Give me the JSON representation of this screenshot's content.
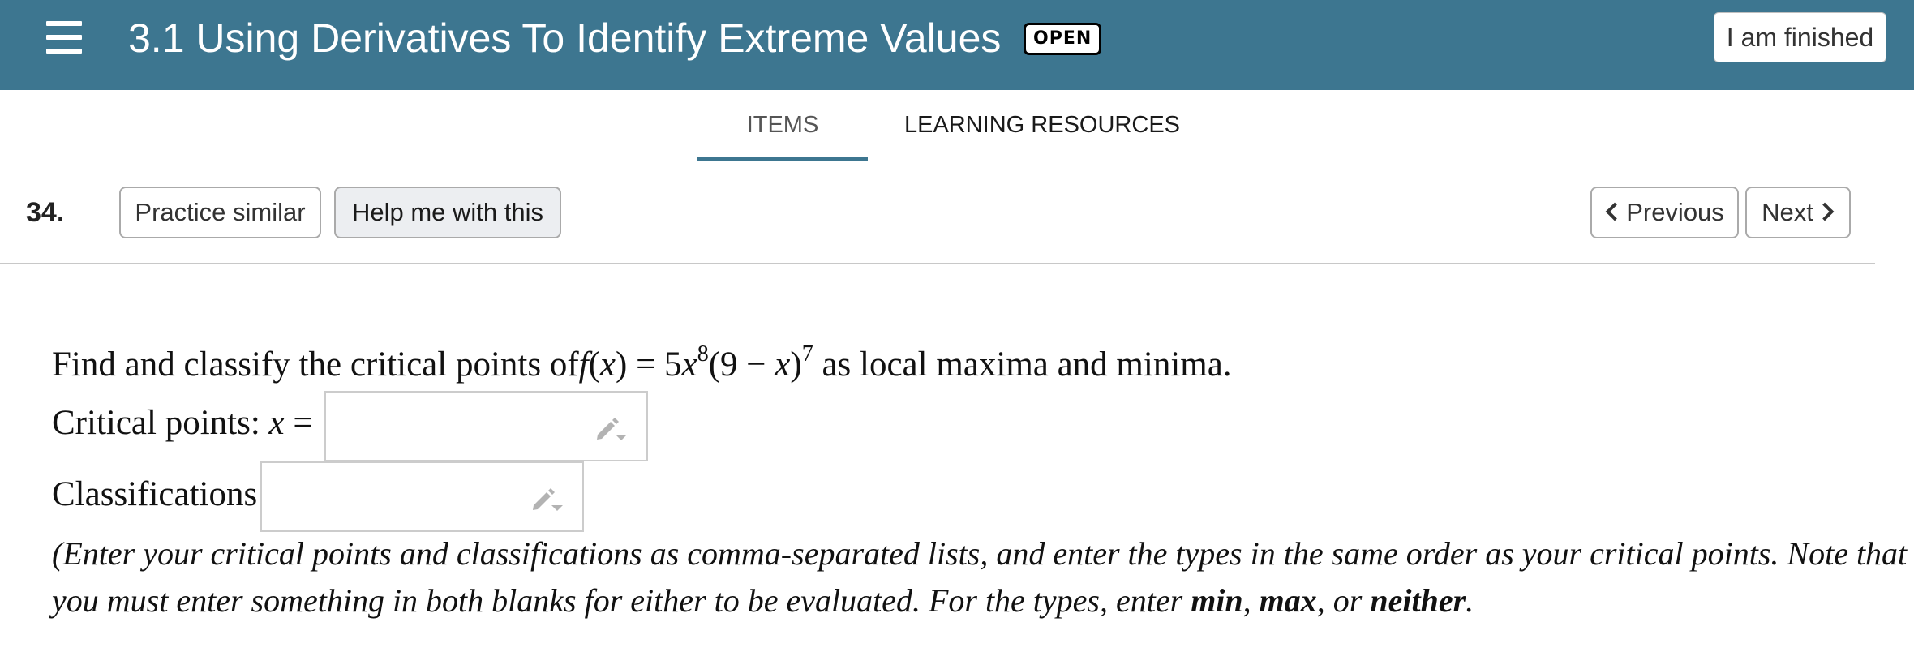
{
  "header": {
    "title": "3.1 Using Derivatives To Identify Extreme Values",
    "status_badge": "OPEN",
    "finish_label": "I am finished",
    "menu_icon": "hamburger-menu-icon"
  },
  "tabs": [
    {
      "label": "ITEMS",
      "active": true
    },
    {
      "label": "LEARNING RESOURCES",
      "active": false
    }
  ],
  "toolbar": {
    "question_number": "34.",
    "practice_label": "Practice similar",
    "help_label": "Help me with this",
    "previous_label": "Previous",
    "next_label": "Next"
  },
  "question": {
    "prompt_before": "Find and classify the critical points of",
    "prompt_fx": "f",
    "prompt_x": "x",
    "prompt_eq": " = 5",
    "prompt_x2": "x",
    "prompt_exp1": "8",
    "prompt_mid": "(9 − ",
    "prompt_x3": "x",
    "prompt_close": ")",
    "prompt_exp2": "7",
    "prompt_after": " as local maxima and minima.",
    "critical_label": "Critical points: ",
    "critical_var": "x",
    "critical_eq": " =",
    "critical_value": "",
    "classification_label": "Classifications:",
    "classification_value": "",
    "instruction_line1": "(Enter your critical points and classifications as comma-separated lists, and enter the types in the same order as your critical points. Note that",
    "instruction_line2_before": "you must enter something in both blanks for either to be evaluated. For the types, enter ",
    "type_min": "min",
    "sep1": ", ",
    "type_max": "max",
    "sep2": ", or ",
    "type_neither": "neither",
    "instruction_end": "."
  },
  "colors": {
    "header_bg": "#3d7690",
    "active_tab_underline": "#3d7690"
  }
}
